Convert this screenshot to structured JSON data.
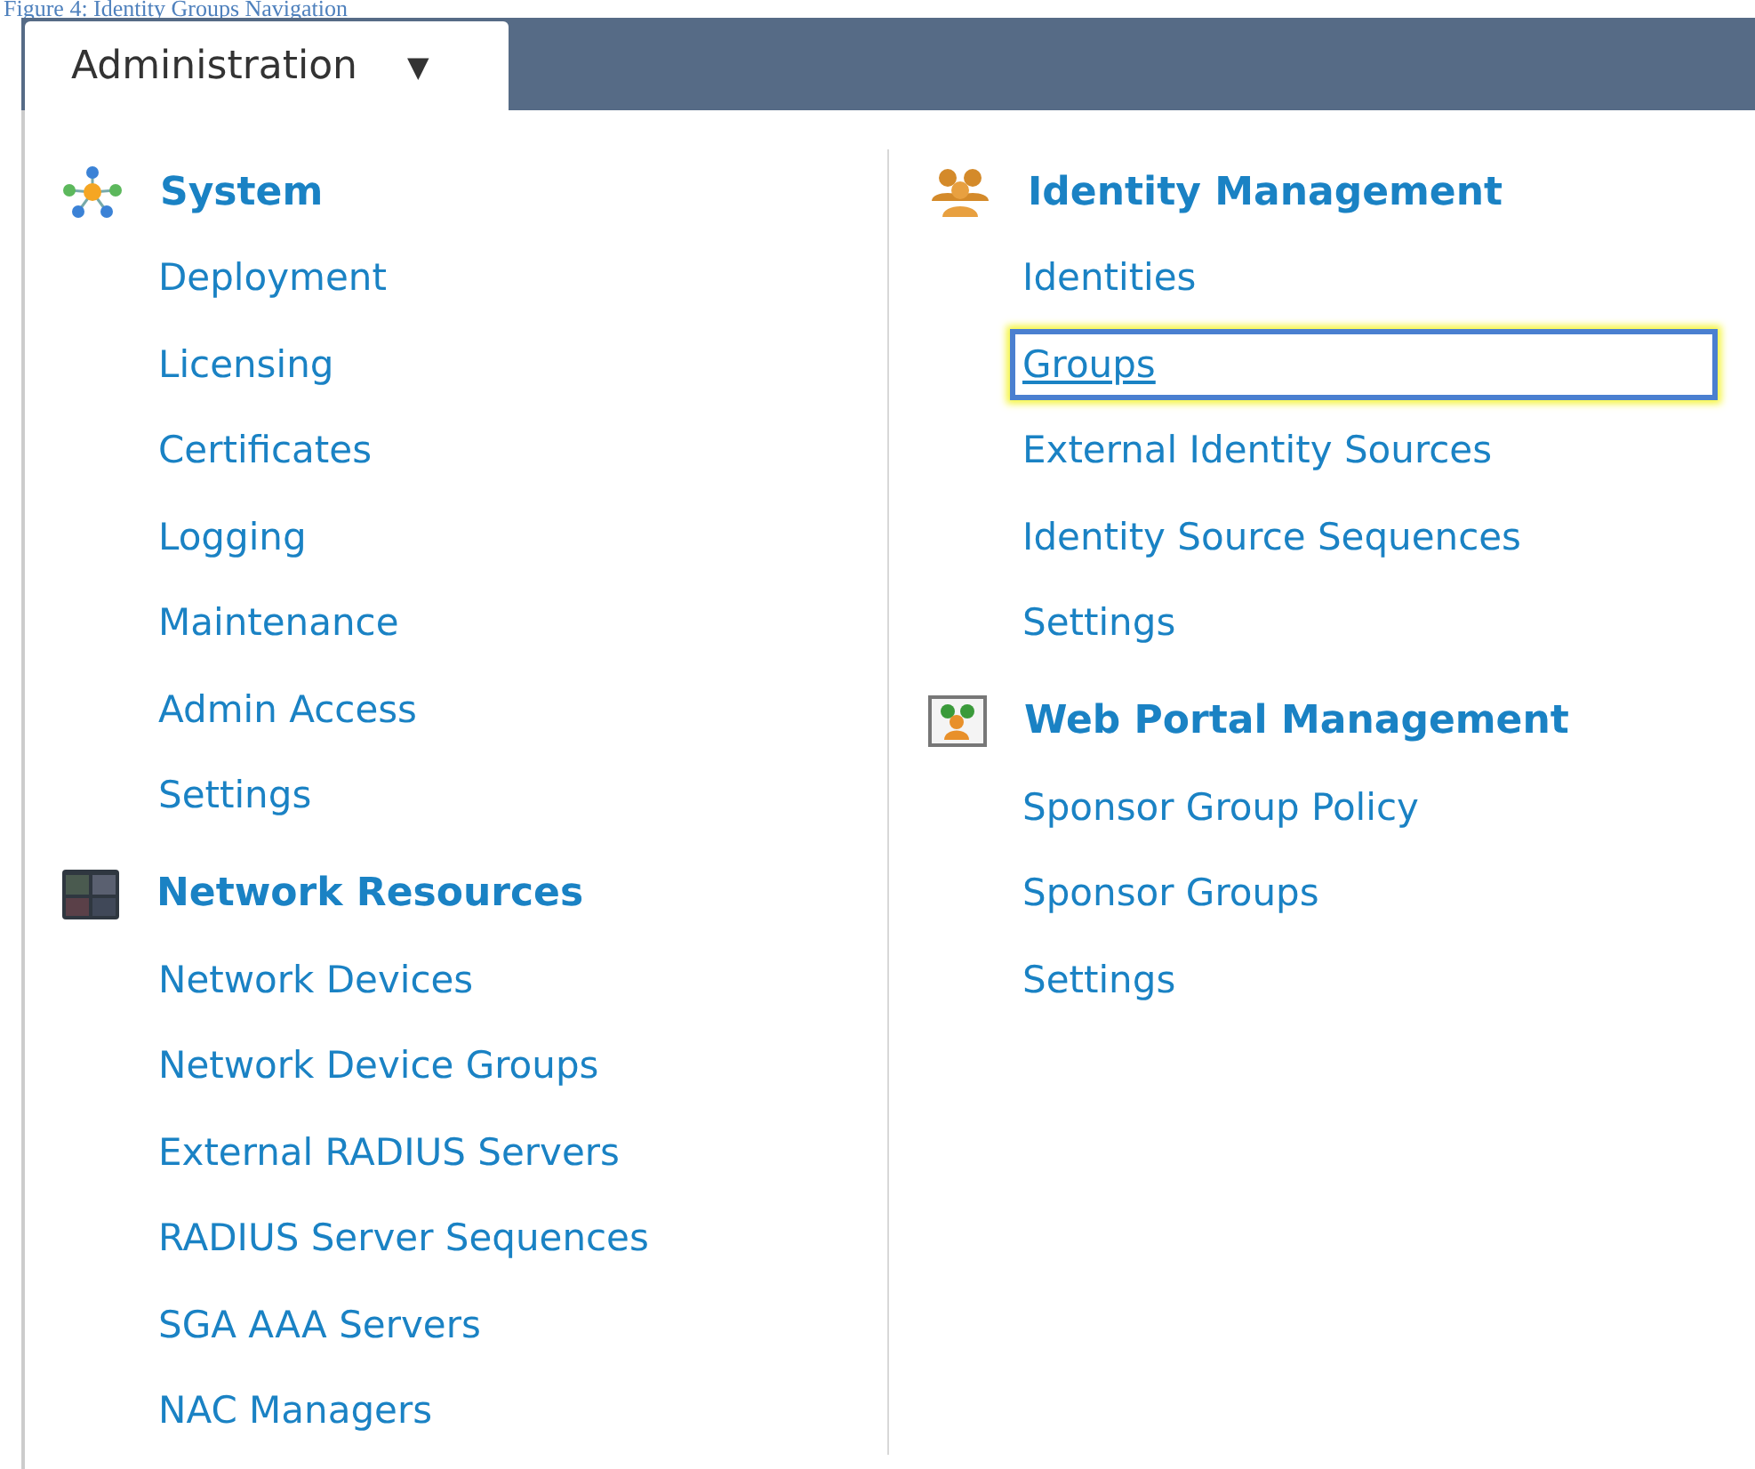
{
  "caption": "Figure 4: Identity Groups Navigation",
  "menu_tab": {
    "label": "Administration",
    "caret": "▼"
  },
  "columns": [
    {
      "sections": [
        {
          "title": "System",
          "items": [
            {
              "label": "Deployment",
              "selected": false
            },
            {
              "label": "Licensing",
              "selected": false
            },
            {
              "label": "Certificates",
              "selected": false
            },
            {
              "label": "Logging",
              "selected": false
            },
            {
              "label": "Maintenance",
              "selected": false
            },
            {
              "label": "Admin Access",
              "selected": false
            },
            {
              "label": "Settings",
              "selected": false
            }
          ]
        },
        {
          "title": "Network Resources",
          "items": [
            {
              "label": "Network Devices",
              "selected": false
            },
            {
              "label": "Network Device Groups",
              "selected": false
            },
            {
              "label": "External RADIUS Servers",
              "selected": false
            },
            {
              "label": "RADIUS Server Sequences",
              "selected": false
            },
            {
              "label": "SGA AAA Servers",
              "selected": false
            },
            {
              "label": "NAC Managers",
              "selected": false
            }
          ]
        }
      ]
    },
    {
      "sections": [
        {
          "title": "Identity Management",
          "items": [
            {
              "label": "Identities",
              "selected": false
            },
            {
              "label": "Groups",
              "selected": true
            },
            {
              "label": "External Identity Sources",
              "selected": false
            },
            {
              "label": "Identity Source Sequences",
              "selected": false
            },
            {
              "label": "Settings",
              "selected": false
            }
          ]
        },
        {
          "title": "Web Portal Management",
          "items": [
            {
              "label": "Sponsor Group Policy",
              "selected": false
            },
            {
              "label": "Sponsor Groups",
              "selected": false
            },
            {
              "label": "Settings",
              "selected": false
            }
          ]
        }
      ]
    }
  ]
}
